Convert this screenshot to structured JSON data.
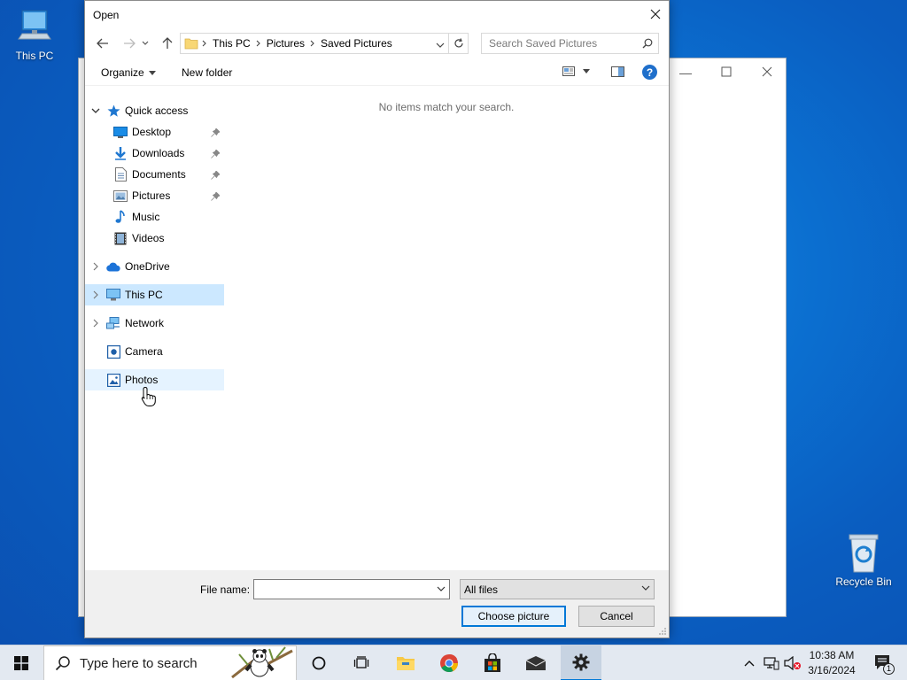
{
  "desktop": {
    "this_pc_label": "This PC",
    "recycle_bin_label": "Recycle Bin"
  },
  "dialog": {
    "title": "Open",
    "breadcrumb": [
      "This PC",
      "Pictures",
      "Saved Pictures"
    ],
    "search_placeholder": "Search Saved Pictures",
    "toolbar": {
      "organize": "Organize",
      "new_folder": "New folder",
      "help": "?"
    },
    "nav": {
      "quick_access": "Quick access",
      "desktop": "Desktop",
      "downloads": "Downloads",
      "documents": "Documents",
      "pictures": "Pictures",
      "music": "Music",
      "videos": "Videos",
      "onedrive": "OneDrive",
      "this_pc": "This PC",
      "network": "Network",
      "camera": "Camera",
      "photos": "Photos"
    },
    "empty_message": "No items match your search.",
    "file_name_label": "File name:",
    "file_name_value": "",
    "file_type": "All files",
    "choose_button": "Choose picture",
    "cancel_button": "Cancel"
  },
  "taskbar": {
    "search_placeholder": "Type here to search",
    "time": "10:38 AM",
    "date": "3/16/2024",
    "notification_count": "1"
  },
  "colors": {
    "selection": "#cce8ff",
    "hover": "#e5f3ff",
    "accent": "#0078d7",
    "desktop_blue": "#0b6fd0"
  }
}
